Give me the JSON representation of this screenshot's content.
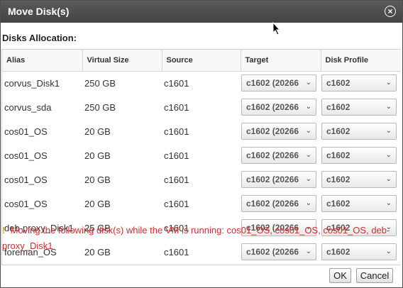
{
  "dialog": {
    "title": "Move Disk(s)",
    "close_icon": "×",
    "section_label": "Disks Allocation:"
  },
  "table": {
    "columns": [
      "Alias",
      "Virtual Size",
      "Source",
      "Target",
      "Disk Profile"
    ],
    "rows": [
      {
        "alias": "corvus_Disk1",
        "size": "250 GB",
        "source": "c1601",
        "target": "c1602 (20266",
        "profile": "c1602"
      },
      {
        "alias": "corvus_sda",
        "size": "250 GB",
        "source": "c1601",
        "target": "c1602 (20266",
        "profile": "c1602"
      },
      {
        "alias": "cos01_OS",
        "size": "20 GB",
        "source": "c1601",
        "target": "c1602 (20266",
        "profile": "c1602"
      },
      {
        "alias": "cos01_OS",
        "size": "20 GB",
        "source": "c1601",
        "target": "c1602 (20266",
        "profile": "c1602"
      },
      {
        "alias": "cos01_OS",
        "size": "20 GB",
        "source": "c1601",
        "target": "c1602 (20266",
        "profile": "c1602"
      },
      {
        "alias": "cos01_OS",
        "size": "20 GB",
        "source": "c1601",
        "target": "c1602 (20266",
        "profile": "c1602"
      },
      {
        "alias": "deb-proxy_Disk1",
        "size": "25 GB",
        "source": "c1601",
        "target": "c1602 (20266",
        "profile": "c1602"
      },
      {
        "alias": "foreman_OS",
        "size": "20 GB",
        "source": "c1601",
        "target": "c1602 (20266",
        "profile": "c1602"
      }
    ]
  },
  "warning": {
    "icon": "!",
    "text": "Moving the following disk(s) while the VM is running: cos01_OS, cos01_OS, cos01_OS, deb-proxy_Disk1"
  },
  "buttons": {
    "ok": "OK",
    "cancel": "Cancel"
  },
  "icons": {
    "dropdown": "⌄"
  }
}
